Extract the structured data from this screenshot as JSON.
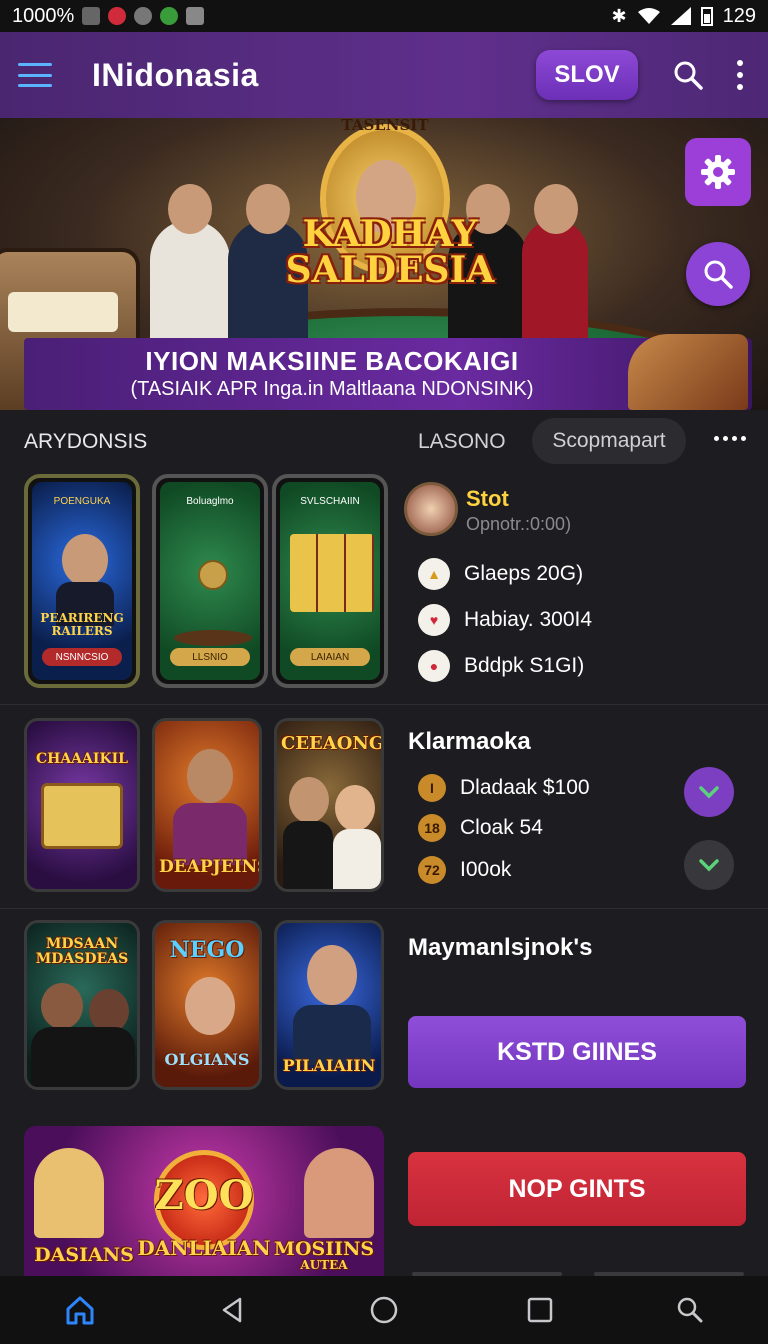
{
  "status_bar": {
    "left_text": "1000%",
    "battery": "129"
  },
  "app_bar": {
    "title": "INidonasia",
    "slov_label": "SLOV"
  },
  "hero": {
    "badge": "TASENSIT",
    "title_line1": "KADHAY",
    "title_line2": "SALDESIA"
  },
  "promo": {
    "headline": "IYION MAKSIINE BACOKAIGI",
    "subline": "(TASIAIK APR Inga.in Maltlaana NDONSINK)"
  },
  "tabs": {
    "left": "ARYDONSIS",
    "middle": "LASONO",
    "selected": "Scopmapart"
  },
  "row1": {
    "phones": [
      {
        "top_label": "POENGUKA",
        "title": "PEARIRENG RAILERS",
        "button": "NSNNCSIO"
      },
      {
        "top_label": "Boluaglmo",
        "button": "LLSNIO"
      },
      {
        "top_label": "SVLSCHAIIN",
        "button": "LAIAIAN"
      }
    ],
    "profile": {
      "name": "Stot",
      "subtitle": "Opnotr.:0:00)"
    },
    "items": [
      {
        "icon": "bag-icon",
        "label": "Glaeps 20G)"
      },
      {
        "icon": "heart-icon",
        "label": "Habiay. 300I4"
      },
      {
        "icon": "chip-icon",
        "label": "Bddpk S1GI)"
      }
    ]
  },
  "row2": {
    "thumbs": [
      "CHAAAIKIL",
      "DEAPJEINS",
      "CEEAONG"
    ],
    "heading": "Klarmaoka",
    "items": [
      {
        "badge": "I",
        "label": "Dladaak $100"
      },
      {
        "badge": "18",
        "label": "Cloak 54"
      },
      {
        "badge": "72",
        "label": "I00ok"
      }
    ]
  },
  "row3": {
    "thumbs": [
      {
        "top": "MDSAAN",
        "bottom": "MDASDEAS"
      },
      {
        "top": "NEGO",
        "bottom": "OLGIANS"
      },
      {
        "top": "",
        "bottom": "PILAIAIIN"
      }
    ],
    "heading": "Maymanlsjnok's",
    "primary_button": "KSTD GIINES"
  },
  "row4": {
    "banner": {
      "left": "DASIANS",
      "center_big": "ZOO",
      "center": "DANLIAIAN",
      "right": "MOSIINS",
      "right_sub": "AUTEA"
    },
    "danger_button": "NOP GINTS"
  },
  "colors": {
    "accent": "#8b45d4",
    "appbar": "#5a2d86",
    "danger": "#cf2a3a",
    "gold": "#ffd23f"
  }
}
